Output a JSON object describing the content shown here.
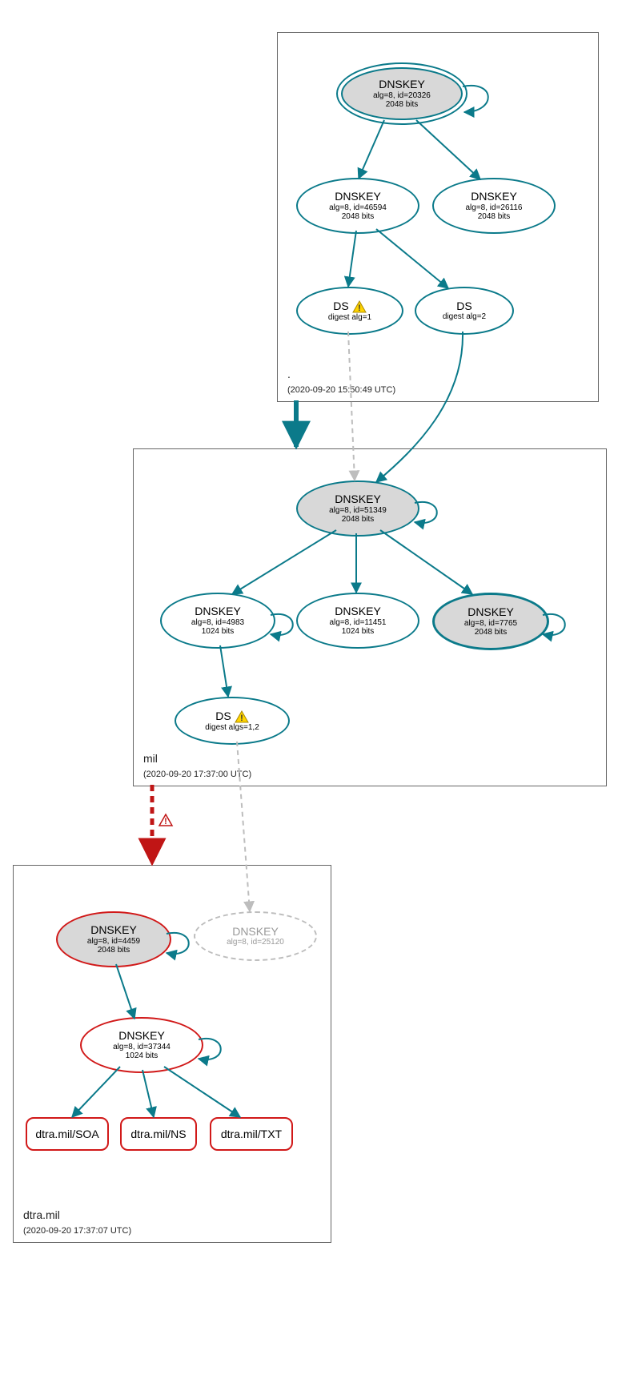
{
  "zones": {
    "root": {
      "label": ".",
      "timestamp": "(2020-09-20 15:50:49 UTC)"
    },
    "mil": {
      "label": "mil",
      "timestamp": "(2020-09-20 17:37:00 UTC)"
    },
    "dtra": {
      "label": "dtra.mil",
      "timestamp": "(2020-09-20 17:37:07 UTC)"
    }
  },
  "nodes": {
    "root_ksk": {
      "title": "DNSKEY",
      "line1": "alg=8, id=20326",
      "line2": "2048 bits"
    },
    "root_zsk1": {
      "title": "DNSKEY",
      "line1": "alg=8, id=46594",
      "line2": "2048 bits"
    },
    "root_zsk2": {
      "title": "DNSKEY",
      "line1": "alg=8, id=26116",
      "line2": "2048 bits"
    },
    "root_ds1": {
      "title": "DS",
      "line1": "digest alg=1"
    },
    "root_ds2": {
      "title": "DS",
      "line1": "digest alg=2"
    },
    "mil_ksk": {
      "title": "DNSKEY",
      "line1": "alg=8, id=51349",
      "line2": "2048 bits"
    },
    "mil_zsk1": {
      "title": "DNSKEY",
      "line1": "alg=8, id=4983",
      "line2": "1024 bits"
    },
    "mil_zsk2": {
      "title": "DNSKEY",
      "line1": "alg=8, id=11451",
      "line2": "1024 bits"
    },
    "mil_zsk3": {
      "title": "DNSKEY",
      "line1": "alg=8, id=7765",
      "line2": "2048 bits"
    },
    "mil_ds": {
      "title": "DS",
      "line1": "digest algs=1,2"
    },
    "dtra_ksk": {
      "title": "DNSKEY",
      "line1": "alg=8, id=4459",
      "line2": "2048 bits"
    },
    "dtra_zsk": {
      "title": "DNSKEY",
      "line1": "alg=8, id=37344",
      "line2": "1024 bits"
    },
    "dtra_missing": {
      "title": "DNSKEY",
      "line1": "alg=8, id=25120"
    },
    "rr_soa": {
      "label": "dtra.mil/SOA"
    },
    "rr_ns": {
      "label": "dtra.mil/NS"
    },
    "rr_txt": {
      "label": "dtra.mil/TXT"
    }
  },
  "colors": {
    "teal": "#0b7a8a",
    "red": "#d11919",
    "gray": "#bdbdbd",
    "fillGray": "#d8d8d8"
  }
}
